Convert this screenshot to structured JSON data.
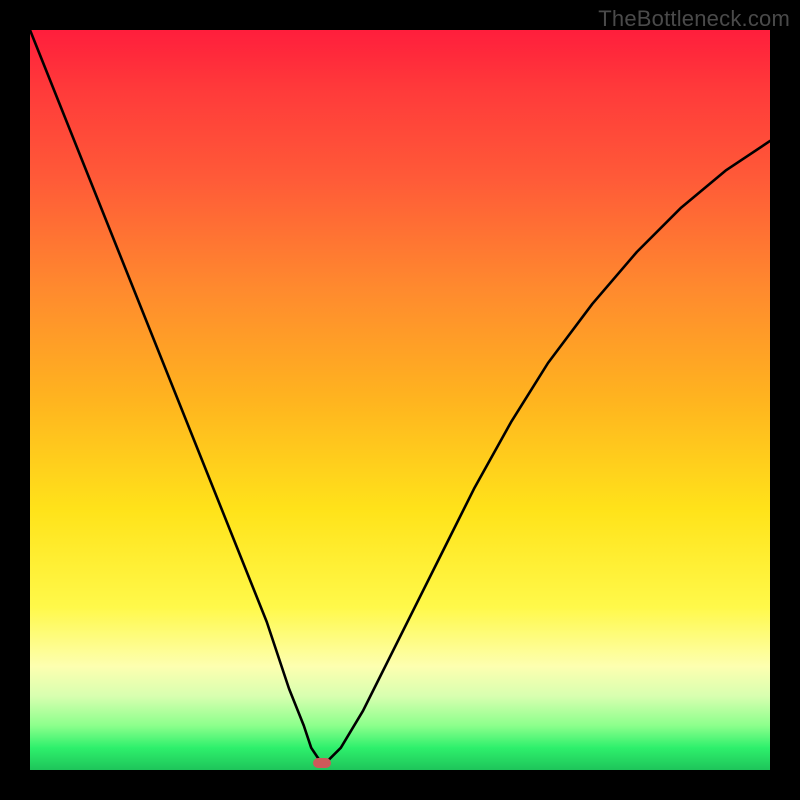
{
  "watermark": {
    "text": "TheBottleneck.com"
  },
  "chart_data": {
    "type": "line",
    "title": "",
    "xlabel": "",
    "ylabel": "",
    "xlim": [
      0,
      100
    ],
    "ylim": [
      0,
      100
    ],
    "background_gradient": {
      "direction": "vertical",
      "stops": [
        {
          "pos": 0.0,
          "color": "#ff1e3c"
        },
        {
          "pos": 0.35,
          "color": "#ff8a2e"
        },
        {
          "pos": 0.65,
          "color": "#ffe31a"
        },
        {
          "pos": 0.88,
          "color": "#fdffb0"
        },
        {
          "pos": 0.97,
          "color": "#2ef06c"
        },
        {
          "pos": 1.0,
          "color": "#1ec45a"
        }
      ]
    },
    "series": [
      {
        "name": "bottleneck-curve",
        "x": [
          0,
          4,
          8,
          12,
          16,
          20,
          24,
          28,
          32,
          35,
          37,
          38,
          39,
          40,
          42,
          45,
          48,
          52,
          56,
          60,
          65,
          70,
          76,
          82,
          88,
          94,
          100
        ],
        "y": [
          100,
          90,
          80,
          70,
          60,
          50,
          40,
          30,
          20,
          11,
          6,
          3,
          1.5,
          1,
          3,
          8,
          14,
          22,
          30,
          38,
          47,
          55,
          63,
          70,
          76,
          81,
          85
        ]
      }
    ],
    "annotations": [
      {
        "name": "min-marker",
        "x": 39.5,
        "y": 1.0,
        "color": "#cc5a5a",
        "shape": "pill"
      }
    ]
  }
}
